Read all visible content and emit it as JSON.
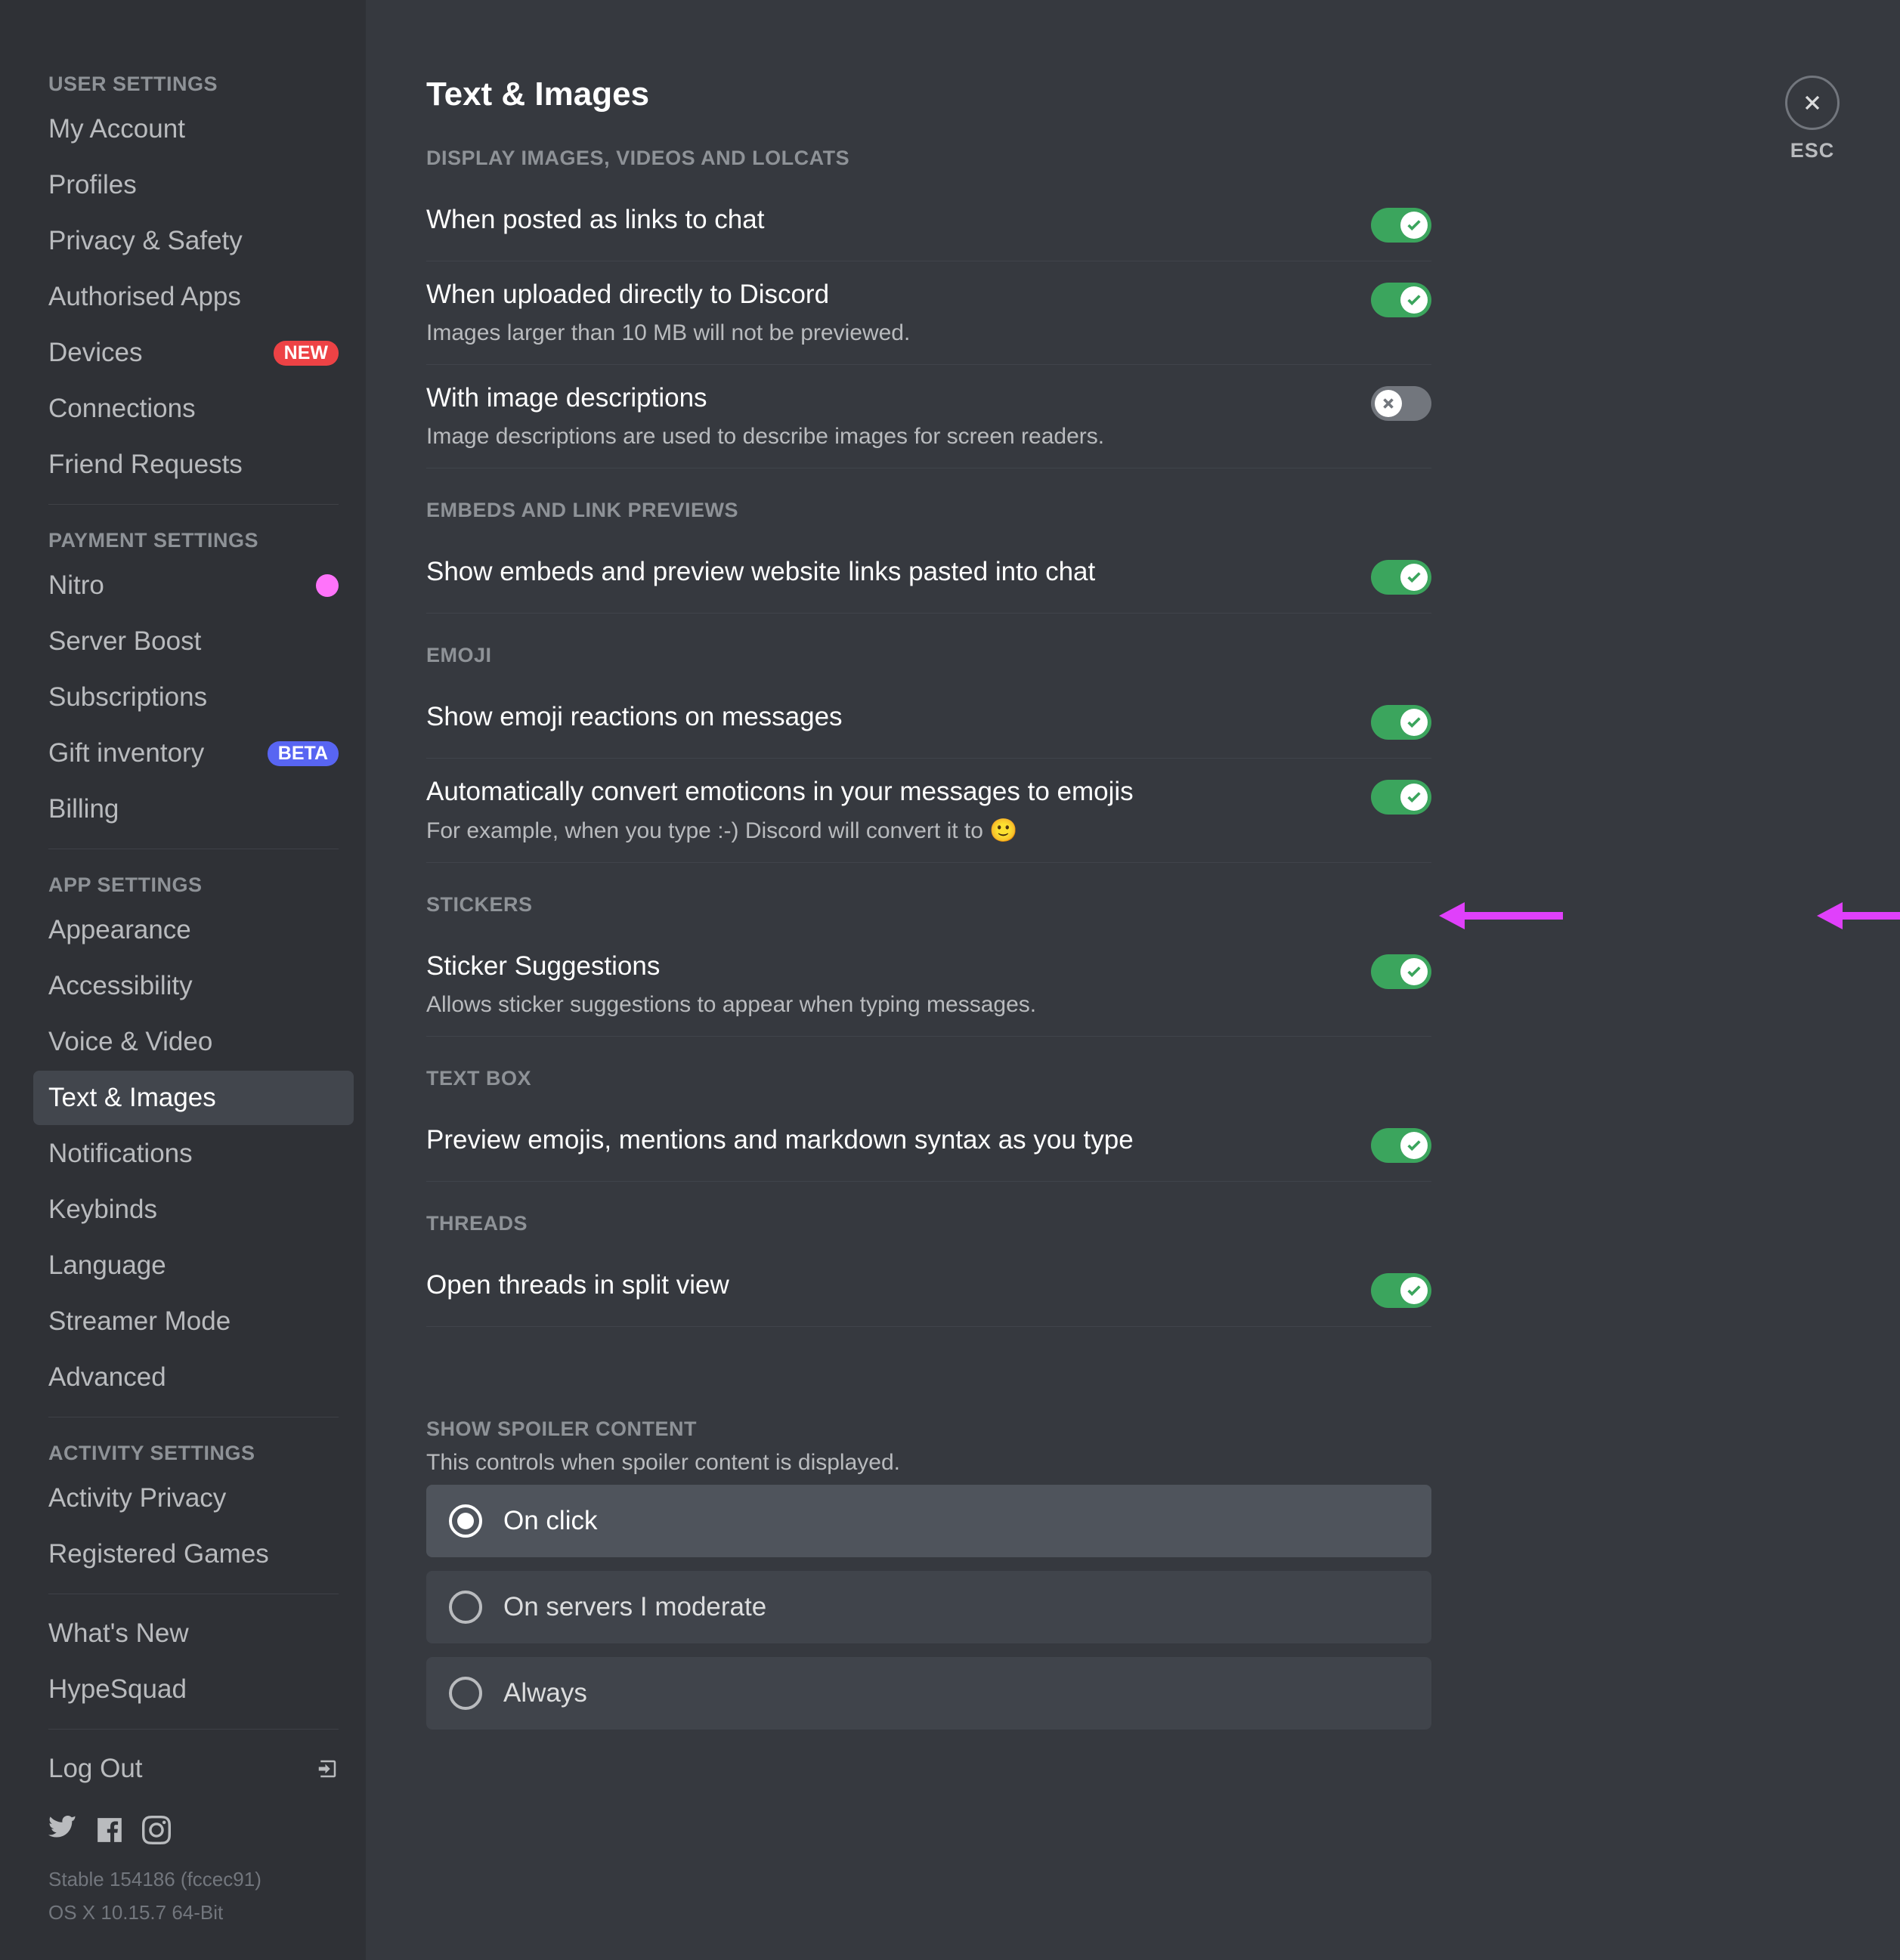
{
  "sidebar": {
    "groups": [
      {
        "title": "USER SETTINGS",
        "items": [
          {
            "label": "My Account"
          },
          {
            "label": "Profiles"
          },
          {
            "label": "Privacy & Safety"
          },
          {
            "label": "Authorised Apps"
          },
          {
            "label": "Devices",
            "badge": "NEW"
          },
          {
            "label": "Connections"
          },
          {
            "label": "Friend Requests"
          }
        ]
      },
      {
        "title": "PAYMENT SETTINGS",
        "items": [
          {
            "label": "Nitro",
            "badge": "nitro-icon"
          },
          {
            "label": "Server Boost"
          },
          {
            "label": "Subscriptions"
          },
          {
            "label": "Gift inventory",
            "badge": "BETA"
          },
          {
            "label": "Billing"
          }
        ]
      },
      {
        "title": "APP SETTINGS",
        "items": [
          {
            "label": "Appearance"
          },
          {
            "label": "Accessibility"
          },
          {
            "label": "Voice & Video"
          },
          {
            "label": "Text & Images",
            "active": true
          },
          {
            "label": "Notifications"
          },
          {
            "label": "Keybinds"
          },
          {
            "label": "Language"
          },
          {
            "label": "Streamer Mode"
          },
          {
            "label": "Advanced"
          }
        ]
      },
      {
        "title": "ACTIVITY SETTINGS",
        "items": [
          {
            "label": "Activity Privacy"
          },
          {
            "label": "Registered Games"
          }
        ]
      }
    ],
    "extras": [
      {
        "label": "What's New"
      },
      {
        "label": "HypeSquad"
      }
    ],
    "logout": "Log Out",
    "footer1": "Stable 154186 (fccec91)",
    "footer2": "OS X 10.15.7 64-Bit"
  },
  "close_label": "ESC",
  "page_title": "Text & Images",
  "sections": {
    "display": {
      "title": "DISPLAY IMAGES, VIDEOS AND LOLCATS",
      "posted_links": {
        "label": "When posted as links to chat",
        "on": true
      },
      "uploaded": {
        "label": "When uploaded directly to Discord",
        "desc": "Images larger than 10 MB will not be previewed.",
        "on": true
      },
      "img_desc": {
        "label": "With image descriptions",
        "desc": "Image descriptions are used to describe images for screen readers.",
        "on": false
      }
    },
    "embeds": {
      "title": "EMBEDS AND LINK PREVIEWS",
      "show_embeds": {
        "label": "Show embeds and preview website links pasted into chat",
        "on": true
      }
    },
    "emoji": {
      "title": "EMOJI",
      "reactions": {
        "label": "Show emoji reactions on messages",
        "on": true
      },
      "convert": {
        "label": "Automatically convert emoticons in your messages to emojis",
        "desc": "For example, when you type :-) Discord will convert it to 🙂",
        "on": true
      }
    },
    "stickers": {
      "title": "STICKERS",
      "suggestions": {
        "label": "Sticker Suggestions",
        "desc": "Allows sticker suggestions to appear when typing messages.",
        "on": true
      }
    },
    "textbox": {
      "title": "TEXT BOX",
      "preview": {
        "label": "Preview emojis, mentions and markdown syntax as you type",
        "on": true
      }
    },
    "threads": {
      "title": "THREADS",
      "split": {
        "label": "Open threads in split view",
        "on": true
      }
    },
    "spoiler": {
      "title": "SHOW SPOILER CONTENT",
      "desc": "This controls when spoiler content is displayed.",
      "options": [
        {
          "label": "On click",
          "selected": true
        },
        {
          "label": "On servers I moderate",
          "selected": false
        },
        {
          "label": "Always",
          "selected": false
        }
      ]
    }
  }
}
